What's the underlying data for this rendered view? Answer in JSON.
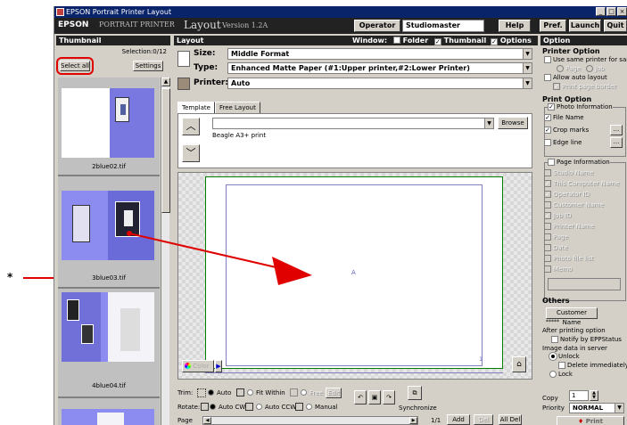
{
  "window": {
    "title": "EPSON Portrait Printer Layout",
    "min": "_",
    "max": "□",
    "close": "×"
  },
  "header": {
    "brand": "EPSON",
    "brand_sub": "PORTRAIT PRINTER",
    "brand_layout": "Layout",
    "version": "Version 1.2A",
    "operator_label": "Operator",
    "operator_value": "Studiomaster",
    "buttons": [
      "Help",
      "Pref.",
      "Launch",
      "Quit"
    ]
  },
  "thumbnail": {
    "title": "Thumbnail",
    "selection": "Selection:0/12",
    "select_all": "Select all",
    "settings": "Settings",
    "items": [
      {
        "label": "2blue02.tif"
      },
      {
        "label": "3blue03.tif"
      },
      {
        "label": "4blue04.tif"
      }
    ]
  },
  "layout": {
    "title": "Layout",
    "window_label": "Window:",
    "window_options": [
      {
        "label": "Folder",
        "checked": false
      },
      {
        "label": "Thumbnail",
        "checked": true
      },
      {
        "label": "Options",
        "checked": true
      }
    ],
    "size_label": "Size:",
    "size_value": "Middle Format",
    "type_label": "Type:",
    "type_value": "Enhanced Matte Paper    (#1:Upper printer,#2:Lower Printer)",
    "printer_label": "Printer:",
    "printer_value": "Auto",
    "tabs": [
      "Template",
      "Free Layout"
    ],
    "browse": "Browse",
    "template_desc": "Beagle A3+ print",
    "canvas_mark": "A",
    "page_no": "1",
    "color": "Color",
    "trim_label": "Trim:",
    "trim_options": [
      "Auto",
      "Fit Within",
      "Free"
    ],
    "edit": "Edit",
    "rotate_label": "Rotate:",
    "rotate_options": [
      "Auto CW",
      "Auto CCW",
      "Manual"
    ],
    "synchronize": "Synchronize",
    "page_label": "Page",
    "page_count": "1/1",
    "add": "Add",
    "del": "Del",
    "all_del": "All Del"
  },
  "options": {
    "title": "Option",
    "printer_option": "Printer Option",
    "use_same": "Use same printer for same",
    "radio_a": "Page",
    "radio_b": "Job",
    "allow_auto": "Allow auto layout",
    "print_page_border": "Print page border",
    "print_option": "Print Option",
    "photo_info": "Photo Information",
    "photo_items": [
      {
        "label": "File Name",
        "checked": true,
        "enabled": true
      },
      {
        "label": "Crop marks",
        "checked": true,
        "enabled": true
      },
      {
        "label": "Edge line",
        "checked": false,
        "enabled": true
      }
    ],
    "page_info": "Page Information",
    "page_items": [
      {
        "label": "Studio Name",
        "checked": false
      },
      {
        "label": "This Computer Name",
        "checked": true
      },
      {
        "label": "Operator ID",
        "checked": true
      },
      {
        "label": "Customer Name",
        "checked": false
      },
      {
        "label": "Job ID",
        "checked": true
      },
      {
        "label": "Printer Name",
        "checked": false
      },
      {
        "label": "Page",
        "checked": false
      },
      {
        "label": "Date",
        "checked": false
      },
      {
        "label": "Photo file list",
        "checked": false
      },
      {
        "label": "Memo",
        "checked": false
      }
    ],
    "others": "Others",
    "customer_name_btn": "Customer Name",
    "customer_name_value": "*****",
    "after_printing": "After printing option",
    "notify": "Notify by EPPStatus",
    "image_data": "Image data in server",
    "unlock": "Unlock",
    "delete_immediately": "Delete immediately",
    "lock": "Lock",
    "copy_label": "Copy",
    "copy_value": "1",
    "priority_label": "Priority",
    "priority_value": "NORMAL",
    "print": "Print"
  },
  "annotation": {
    "marker": "*"
  },
  "colors": {
    "highlight": "#e00000",
    "accent": "#8080e0"
  }
}
